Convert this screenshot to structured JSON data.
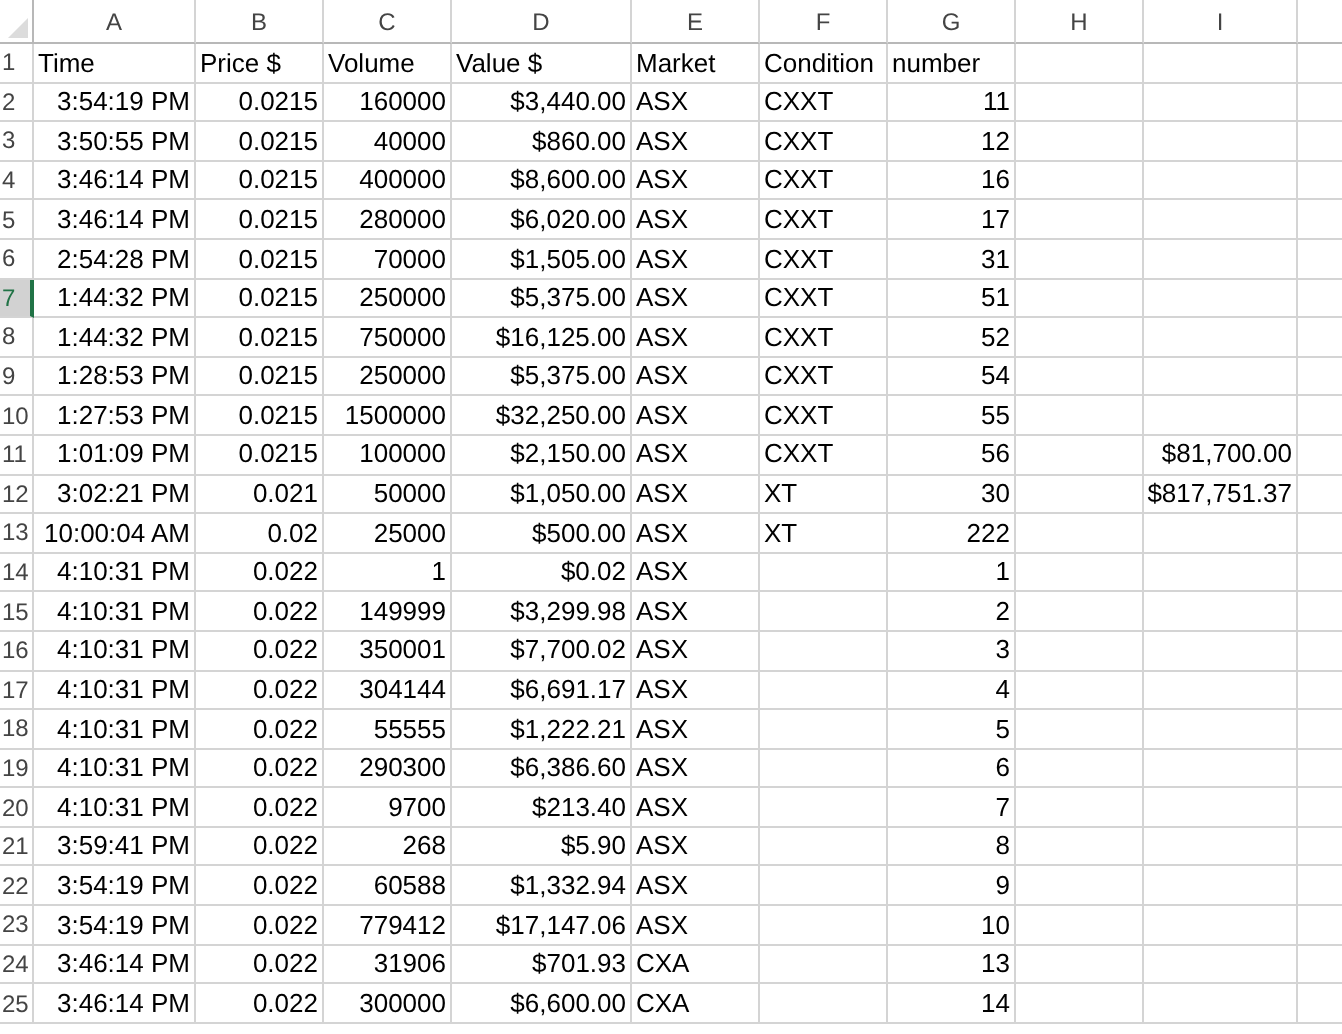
{
  "column_headers": [
    "A",
    "B",
    "C",
    "D",
    "E",
    "F",
    "G",
    "H",
    "I"
  ],
  "header_row": {
    "row": "1",
    "selected": false,
    "cells": [
      "Time",
      "Price $",
      "Volume",
      "Value $",
      "Market",
      "Condition",
      "number"
    ]
  },
  "rows": [
    {
      "row": "2",
      "selected": false,
      "time": "3:54:19 PM",
      "price": "0.0215",
      "volume": "160000",
      "value": "$3,440.00",
      "market": "ASX",
      "condition": "CXXT",
      "number": "11"
    },
    {
      "row": "3",
      "selected": false,
      "time": "3:50:55 PM",
      "price": "0.0215",
      "volume": "40000",
      "value": "$860.00",
      "market": "ASX",
      "condition": "CXXT",
      "number": "12"
    },
    {
      "row": "4",
      "selected": false,
      "time": "3:46:14 PM",
      "price": "0.0215",
      "volume": "400000",
      "value": "$8,600.00",
      "market": "ASX",
      "condition": "CXXT",
      "number": "16"
    },
    {
      "row": "5",
      "selected": false,
      "time": "3:46:14 PM",
      "price": "0.0215",
      "volume": "280000",
      "value": "$6,020.00",
      "market": "ASX",
      "condition": "CXXT",
      "number": "17"
    },
    {
      "row": "6",
      "selected": false,
      "time": "2:54:28 PM",
      "price": "0.0215",
      "volume": "70000",
      "value": "$1,505.00",
      "market": "ASX",
      "condition": "CXXT",
      "number": "31"
    },
    {
      "row": "7",
      "selected": true,
      "time": "1:44:32 PM",
      "price": "0.0215",
      "volume": "250000",
      "value": "$5,375.00",
      "market": "ASX",
      "condition": "CXXT",
      "number": "51"
    },
    {
      "row": "8",
      "selected": false,
      "time": "1:44:32 PM",
      "price": "0.0215",
      "volume": "750000",
      "value": "$16,125.00",
      "market": "ASX",
      "condition": "CXXT",
      "number": "52"
    },
    {
      "row": "9",
      "selected": false,
      "time": "1:28:53 PM",
      "price": "0.0215",
      "volume": "250000",
      "value": "$5,375.00",
      "market": "ASX",
      "condition": "CXXT",
      "number": "54"
    },
    {
      "row": "10",
      "selected": false,
      "time": "1:27:53 PM",
      "price": "0.0215",
      "volume": "1500000",
      "value": "$32,250.00",
      "market": "ASX",
      "condition": "CXXT",
      "number": "55"
    },
    {
      "row": "11",
      "selected": false,
      "time": "1:01:09 PM",
      "price": "0.0215",
      "volume": "100000",
      "value": "$2,150.00",
      "market": "ASX",
      "condition": "CXXT",
      "number": "56",
      "column_i": "$81,700.00"
    },
    {
      "row": "12",
      "selected": false,
      "time": "3:02:21 PM",
      "price": "0.021",
      "volume": "50000",
      "value": "$1,050.00",
      "market": "ASX",
      "condition": "XT",
      "number": "30",
      "column_i": "$817,751.37"
    },
    {
      "row": "13",
      "selected": false,
      "time": "10:00:04 AM",
      "price": "0.02",
      "volume": "25000",
      "value": "$500.00",
      "market": "ASX",
      "condition": "XT",
      "number": "222"
    },
    {
      "row": "14",
      "selected": false,
      "time": "4:10:31 PM",
      "price": "0.022",
      "volume": "1",
      "value": "$0.02",
      "market": "ASX",
      "number": "1"
    },
    {
      "row": "15",
      "selected": false,
      "time": "4:10:31 PM",
      "price": "0.022",
      "volume": "149999",
      "value": "$3,299.98",
      "market": "ASX",
      "number": "2"
    },
    {
      "row": "16",
      "selected": false,
      "time": "4:10:31 PM",
      "price": "0.022",
      "volume": "350001",
      "value": "$7,700.02",
      "market": "ASX",
      "number": "3"
    },
    {
      "row": "17",
      "selected": false,
      "time": "4:10:31 PM",
      "price": "0.022",
      "volume": "304144",
      "value": "$6,691.17",
      "market": "ASX",
      "number": "4"
    },
    {
      "row": "18",
      "selected": false,
      "time": "4:10:31 PM",
      "price": "0.022",
      "volume": "55555",
      "value": "$1,222.21",
      "market": "ASX",
      "number": "5"
    },
    {
      "row": "19",
      "selected": false,
      "time": "4:10:31 PM",
      "price": "0.022",
      "volume": "290300",
      "value": "$6,386.60",
      "market": "ASX",
      "number": "6"
    },
    {
      "row": "20",
      "selected": false,
      "time": "4:10:31 PM",
      "price": "0.022",
      "volume": "9700",
      "value": "$213.40",
      "market": "ASX",
      "number": "7"
    },
    {
      "row": "21",
      "selected": false,
      "time": "3:59:41 PM",
      "price": "0.022",
      "volume": "268",
      "value": "$5.90",
      "market": "ASX",
      "number": "8"
    },
    {
      "row": "22",
      "selected": false,
      "time": "3:54:19 PM",
      "price": "0.022",
      "volume": "60588",
      "value": "$1,332.94",
      "market": "ASX",
      "number": "9"
    },
    {
      "row": "23",
      "selected": false,
      "time": "3:54:19 PM",
      "price": "0.022",
      "volume": "779412",
      "value": "$17,147.06",
      "market": "ASX",
      "number": "10"
    },
    {
      "row": "24",
      "selected": false,
      "time": "3:46:14 PM",
      "price": "0.022",
      "volume": "31906",
      "value": "$701.93",
      "market": "CXA",
      "number": "13"
    },
    {
      "row": "25",
      "selected": false,
      "time": "3:46:14 PM",
      "price": "0.022",
      "volume": "300000",
      "value": "$6,600.00",
      "market": "CXA",
      "number": "14"
    }
  ]
}
